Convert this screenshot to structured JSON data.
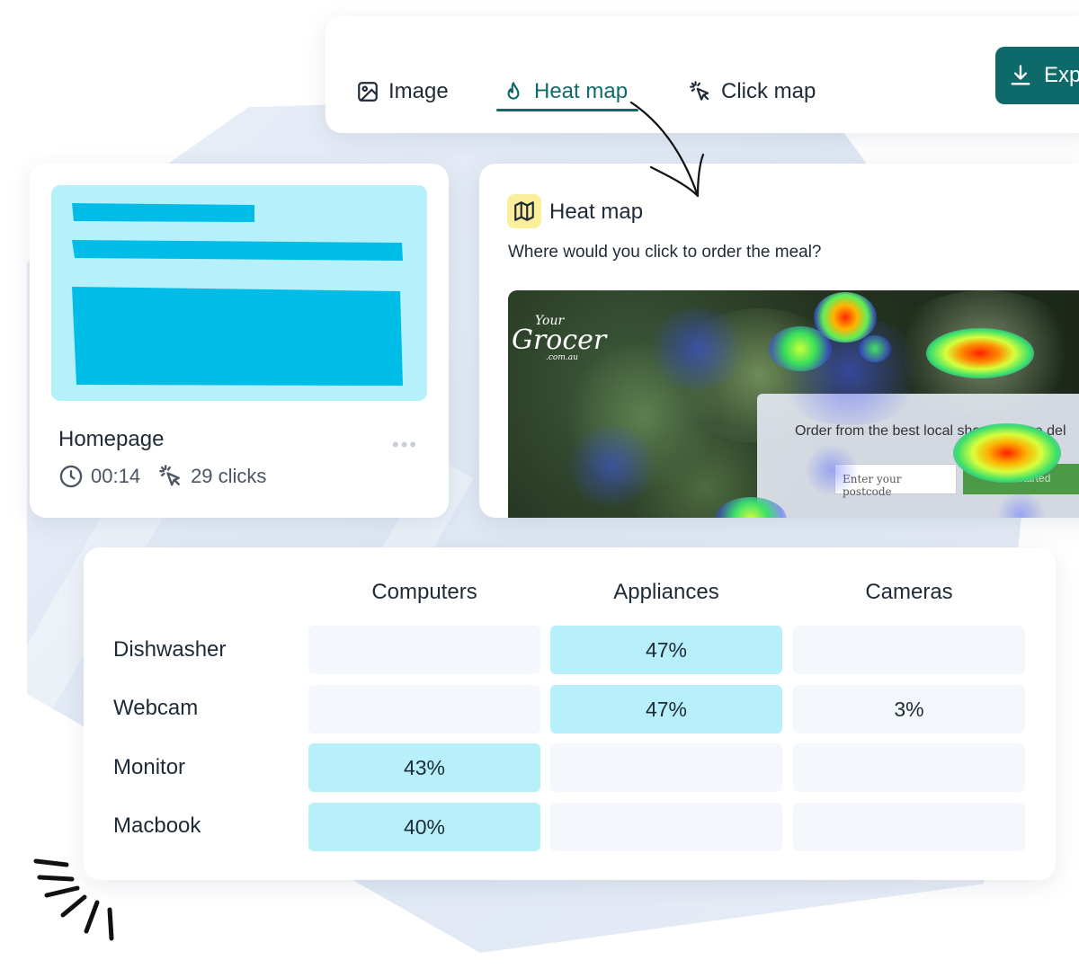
{
  "toolbar": {
    "tabs": [
      {
        "label": "Image",
        "icon": "image-icon"
      },
      {
        "label": "Heat map",
        "icon": "flame-icon",
        "active": true
      },
      {
        "label": "Click map",
        "icon": "cursor-click-icon"
      }
    ],
    "export_label": "Exp"
  },
  "homepage_card": {
    "title": "Homepage",
    "duration": "00:14",
    "clicks": "29 clicks"
  },
  "heatmap_card": {
    "title": "Heat map",
    "question": "Where would you click to order the meal?",
    "preview": {
      "logo_line1": "Your",
      "logo_line2": "Grocer",
      "logo_line3": ".com.au",
      "headline": "Order from the best local shops, in one del",
      "postcode_placeholder": "Enter your postcode",
      "button_label": "Get started"
    }
  },
  "matrix": {
    "columns": [
      "Computers",
      "Appliances",
      "Cameras"
    ],
    "rows": [
      {
        "label": "Dishwasher",
        "cells": [
          "",
          "47%",
          ""
        ]
      },
      {
        "label": "Webcam",
        "cells": [
          "",
          "47%",
          "3%"
        ]
      },
      {
        "label": "Monitor",
        "cells": [
          "43%",
          "",
          ""
        ]
      },
      {
        "label": "Macbook",
        "cells": [
          "40%",
          "",
          ""
        ]
      }
    ]
  },
  "colors": {
    "accent": "#0e6a6a",
    "thumb_bg": "#b6f0fb",
    "thumb_block": "#00bde8",
    "cell_highlight": "#b7effb",
    "cell_empty": "#f4f7fc",
    "map_icon_bg": "#fcef9c"
  }
}
